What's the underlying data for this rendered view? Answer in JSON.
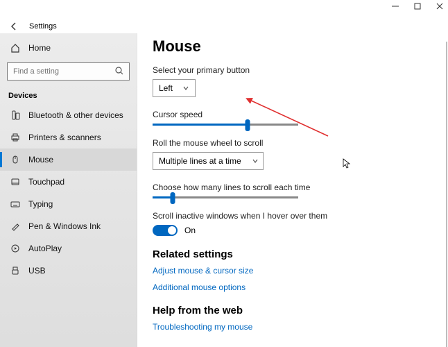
{
  "window": {
    "title": "Settings"
  },
  "sidebar": {
    "home": "Home",
    "search_placeholder": "Find a setting",
    "group": "Devices",
    "items": [
      {
        "label": "Bluetooth & other devices"
      },
      {
        "label": "Printers & scanners"
      },
      {
        "label": "Mouse"
      },
      {
        "label": "Touchpad"
      },
      {
        "label": "Typing"
      },
      {
        "label": "Pen & Windows Ink"
      },
      {
        "label": "AutoPlay"
      },
      {
        "label": "USB"
      }
    ]
  },
  "page": {
    "title": "Mouse",
    "primary_label": "Select your primary button",
    "primary_value": "Left",
    "cursor_speed_label": "Cursor speed",
    "cursor_speed_percent": 65,
    "roll_label": "Roll the mouse wheel to scroll",
    "roll_value": "Multiple lines at a time",
    "lines_label": "Choose how many lines to scroll each time",
    "lines_percent": 14,
    "inactive_label": "Scroll inactive windows when I hover over them",
    "inactive_state": "On",
    "related_heading": "Related settings",
    "related_links": [
      "Adjust mouse & cursor size",
      "Additional mouse options"
    ],
    "help_heading": "Help from the web",
    "help_links": [
      "Troubleshooting my mouse"
    ]
  }
}
